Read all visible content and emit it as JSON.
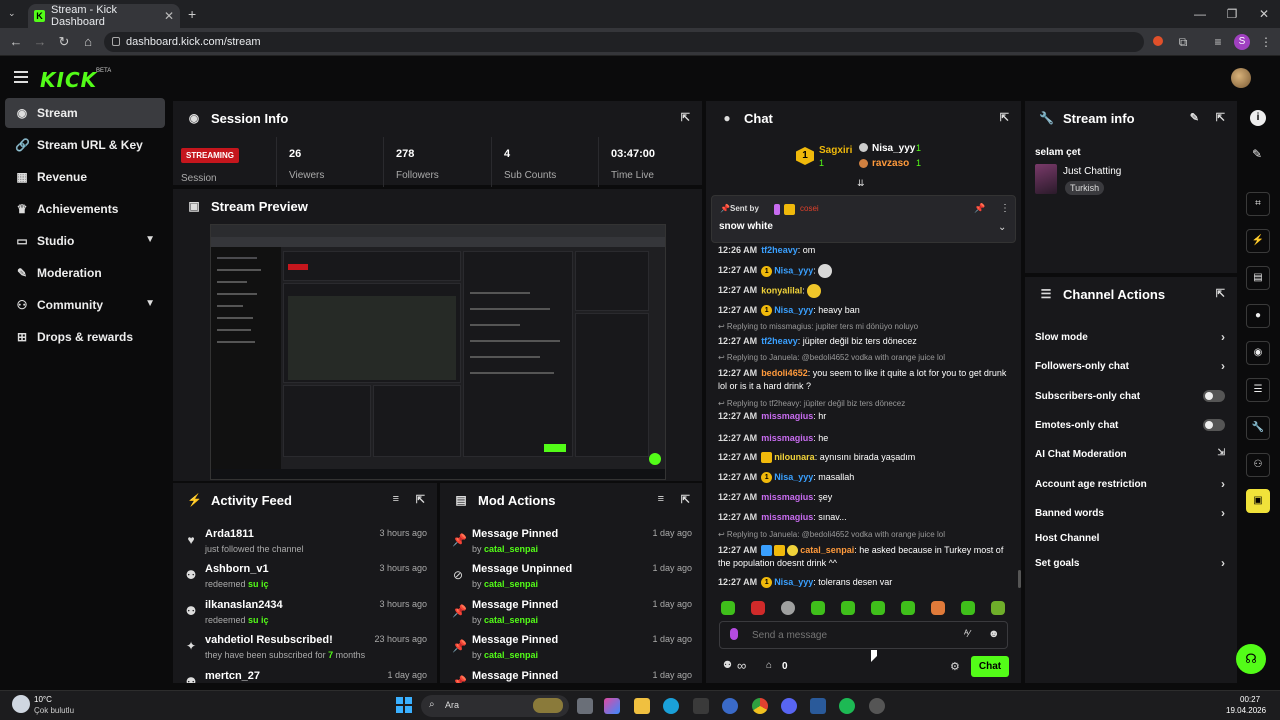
{
  "browser": {
    "tab_title": "Stream - Kick Dashboard",
    "url": "dashboard.kick.com/stream",
    "new_tab": "+",
    "profile_initial": "S"
  },
  "app": {
    "logo": "KICK",
    "beta": "BETA"
  },
  "sidebar": {
    "items": [
      {
        "label": "Stream",
        "icon": "broadcast-icon"
      },
      {
        "label": "Stream URL & Key",
        "icon": "link-icon"
      },
      {
        "label": "Revenue",
        "icon": "chart-icon"
      },
      {
        "label": "Achievements",
        "icon": "trophy-icon"
      },
      {
        "label": "Studio",
        "icon": "studio-icon"
      },
      {
        "label": "Moderation",
        "icon": "wrench-icon"
      },
      {
        "label": "Community",
        "icon": "community-icon"
      },
      {
        "label": "Drops & rewards",
        "icon": "drops-icon"
      }
    ]
  },
  "session": {
    "title": "Session Info",
    "status": "STREAMING",
    "status_label": "Session",
    "stats": [
      {
        "value": "26",
        "label": "Viewers"
      },
      {
        "value": "278",
        "label": "Followers"
      },
      {
        "value": "4",
        "label": "Sub Counts"
      },
      {
        "value": "03:47:00",
        "label": "Time Live"
      }
    ]
  },
  "preview": {
    "title": "Stream Preview"
  },
  "activity": {
    "title": "Activity Feed",
    "rows": [
      {
        "title": "Arda1811",
        "sub": "just followed the channel",
        "highlight": "",
        "time": "3 hours ago",
        "icon": "heart-icon"
      },
      {
        "title": "Ashborn_v1",
        "sub": "redeemed ",
        "highlight": "su iç",
        "time": "3 hours ago",
        "icon": "reward-icon"
      },
      {
        "title": "ilkanaslan2434",
        "sub": "redeemed ",
        "highlight": "su iç",
        "time": "3 hours ago",
        "icon": "reward-icon"
      },
      {
        "title": "vahdetiol Resubscribed!",
        "sub": "they have been subscribed for ",
        "highlight": "7",
        "sub2": " months",
        "time": "23 hours ago",
        "icon": "sparkle-icon"
      },
      {
        "title": "mertcn_27",
        "sub": "",
        "highlight": "",
        "time": "1 day ago",
        "icon": "reward-icon"
      }
    ]
  },
  "mod": {
    "title": "Mod Actions",
    "rows": [
      {
        "title": "Message Pinned",
        "by": "catal_senpai",
        "time": "1 day ago",
        "icon": "pin-icon"
      },
      {
        "title": "Message Unpinned",
        "by": "catal_senpai",
        "time": "1 day ago",
        "icon": "unpin-icon"
      },
      {
        "title": "Message Pinned",
        "by": "catal_senpai",
        "time": "1 day ago",
        "icon": "pin-icon"
      },
      {
        "title": "Message Pinned",
        "by": "catal_senpai",
        "time": "1 day ago",
        "icon": "pin-icon"
      },
      {
        "title": "Message Pinned",
        "by": "",
        "time": "1 day ago",
        "icon": "pin-icon"
      }
    ],
    "by_prefix": "by "
  },
  "chat": {
    "title": "Chat",
    "top_gifters": [
      {
        "name": "Sagxiri",
        "count": "1"
      },
      {
        "name": "Nisa_yyy",
        "count": "1"
      },
      {
        "name": "ravzaso",
        "count": "1"
      }
    ],
    "pinned": {
      "sent_by": "Sent by",
      "sender": "cosei",
      "text": "snow white"
    },
    "messages": [
      {
        "time": "12:26 AM",
        "user": "tf2heavy",
        "color": "#3aa0ff",
        "text": "om",
        "badges": []
      },
      {
        "time": "12:27 AM",
        "user": "Nisa_yyy",
        "color": "#3aa0ff",
        "text": "",
        "badges": [
          "1"
        ],
        "emote": "#d8d8d8"
      },
      {
        "time": "12:27 AM",
        "user": "konyalilal",
        "color": "#f0d23a",
        "text": "",
        "badges": [],
        "emote": "#f0c62a"
      },
      {
        "time": "12:27 AM",
        "user": "Nisa_yyy",
        "color": "#3aa0ff",
        "text": "heavy ban",
        "badges": [
          "1"
        ]
      },
      {
        "reply": "Replying to missmagius: jupiter ters mi dönüyo noluyo",
        "time": "12:27 AM",
        "user": "tf2heavy",
        "color": "#3aa0ff",
        "text": "jüpiter değil biz ters dönecez",
        "badges": []
      },
      {
        "reply": "Replying to Januela: @bedoli4652 vodka with orange juice lol",
        "time": "12:27 AM",
        "user": "bedoli4652",
        "color": "#ff9a3c",
        "text": "you seem to like it quite a lot for you to get drunk lol or is it a hard drink ?",
        "badges": []
      },
      {
        "reply": "Replying to tf2heavy: jüpiter değil biz ters dönecez",
        "time": "12:27 AM",
        "user": "missmagius",
        "color": "#c86cf0",
        "text": "hr",
        "badges": []
      },
      {
        "time": "12:27 AM",
        "user": "missmagius",
        "color": "#c86cf0",
        "text": "he",
        "badges": []
      },
      {
        "time": "12:27 AM",
        "user": "nilounara",
        "color": "#f0d23a",
        "text": "aynısını birada yaşadım",
        "badges": [
          "crown"
        ]
      },
      {
        "time": "12:27 AM",
        "user": "Nisa_yyy",
        "color": "#3aa0ff",
        "text": "masallah",
        "badges": [
          "1"
        ]
      },
      {
        "time": "12:27 AM",
        "user": "missmagius",
        "color": "#c86cf0",
        "text": "şey",
        "badges": []
      },
      {
        "time": "12:27 AM",
        "user": "missmagius",
        "color": "#c86cf0",
        "text": "sınav...",
        "badges": []
      },
      {
        "reply": "Replying to Januela: @bedoli4652 vodka with orange juice lol",
        "time": "12:27 AM",
        "user": "catal_senpai",
        "color": "#ff9a3c",
        "text": "he asked because in Turkey most of the population doesnt drink ^^",
        "badges": [
          "mod",
          "crown",
          "gift"
        ]
      },
      {
        "time": "12:27 AM",
        "user": "Nisa_yyy",
        "color": "#3aa0ff",
        "text": "tolerans desen var",
        "badges": [
          "1"
        ]
      }
    ],
    "input_placeholder": "Send a message",
    "infinity": "∞",
    "points": "0",
    "send_label": "Chat"
  },
  "stream_info": {
    "title": "Stream info",
    "stream_title": "selam çet",
    "category": "Just Chatting",
    "tag": "Turkish"
  },
  "channel_actions": {
    "title": "Channel Actions",
    "items": [
      {
        "label": "Slow mode",
        "control": "arrow"
      },
      {
        "label": "Followers-only chat",
        "control": "arrow"
      },
      {
        "label": "Subscribers-only chat",
        "control": "toggle"
      },
      {
        "label": "Emotes-only chat",
        "control": "toggle"
      },
      {
        "label": "AI Chat Moderation",
        "control": "external"
      },
      {
        "label": "Account age restriction",
        "control": "arrow"
      },
      {
        "label": "Banned words",
        "control": "arrow"
      },
      {
        "label": "Host Channel",
        "control": "none"
      },
      {
        "label": "Set goals",
        "control": "arrow"
      }
    ]
  },
  "taskbar": {
    "weather_temp": "10°C",
    "weather_desc": "Çok bulutlu",
    "search": "Ara",
    "time": "00:27",
    "date": "19.04.2026"
  },
  "colors": {
    "accent": "#53fc18",
    "panel": "#18181b",
    "live": "#c5161d"
  }
}
